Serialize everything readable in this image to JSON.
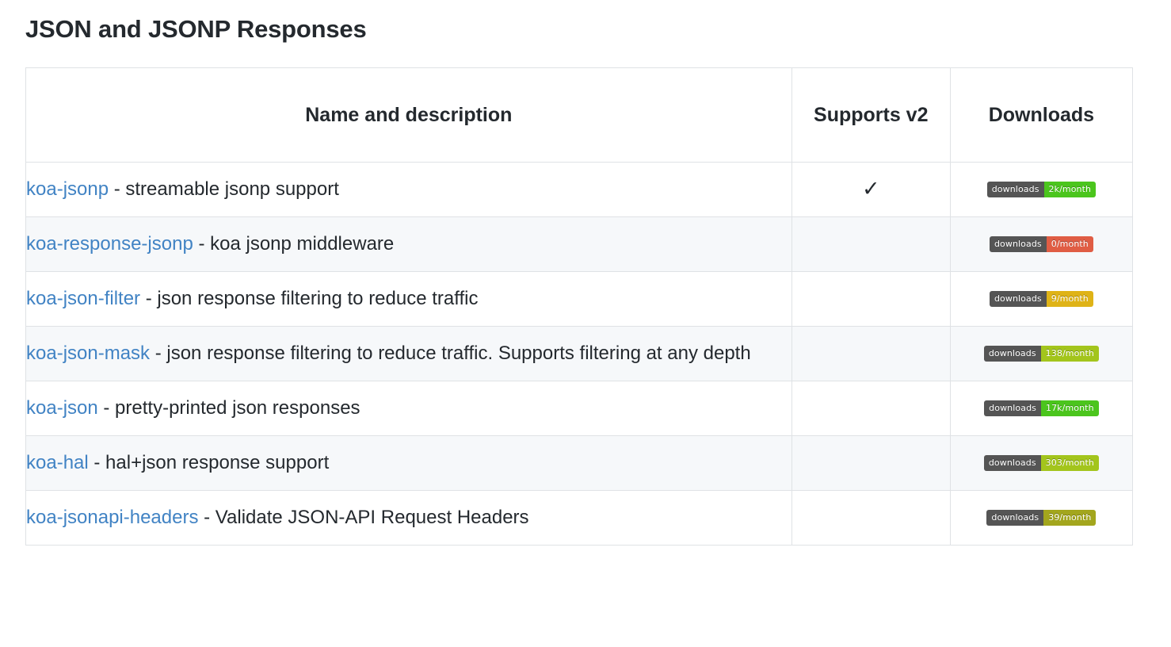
{
  "page": {
    "title": "JSON and JSONP Responses"
  },
  "table": {
    "columns": [
      {
        "key": "name",
        "label": "Name and description"
      },
      {
        "key": "v2",
        "label": "Supports v2"
      },
      {
        "key": "downloads",
        "label": "Downloads"
      }
    ],
    "check_glyph": "✓",
    "badge_label": "downloads",
    "badge_colors": {
      "brightgreen": "#4bc51d",
      "green": "#4bc51d",
      "yellowgreen": "#a3c51c",
      "olive": "#a3a61d",
      "yellow": "#dfb317",
      "red": "#e05d44",
      "label_gray": "#555555"
    },
    "rows": [
      {
        "name": "koa-jsonp",
        "separator": " - ",
        "description": "streamable jsonp support",
        "supports_v2": true,
        "downloads_label": "downloads",
        "downloads_value": "2k/month",
        "downloads_color": "#4bc51d"
      },
      {
        "name": "koa-response-jsonp",
        "separator": " - ",
        "description": "koa jsonp middleware",
        "supports_v2": false,
        "downloads_label": "downloads",
        "downloads_value": "0/month",
        "downloads_color": "#e05d44"
      },
      {
        "name": "koa-json-filter",
        "separator": " - ",
        "description": "json response filtering to reduce traffic",
        "supports_v2": false,
        "downloads_label": "downloads",
        "downloads_value": "9/month",
        "downloads_color": "#dfb317"
      },
      {
        "name": "koa-json-mask",
        "separator": " - ",
        "description": "json response filtering to reduce traffic. Supports filtering at any depth",
        "supports_v2": false,
        "downloads_label": "downloads",
        "downloads_value": "138/month",
        "downloads_color": "#a3c51c"
      },
      {
        "name": "koa-json",
        "separator": " - ",
        "description": "pretty-printed json responses",
        "supports_v2": false,
        "downloads_label": "downloads",
        "downloads_value": "17k/month",
        "downloads_color": "#4bc51d"
      },
      {
        "name": "koa-hal",
        "separator": " - ",
        "description": "hal+json response support",
        "supports_v2": false,
        "downloads_label": "downloads",
        "downloads_value": "303/month",
        "downloads_color": "#a3c51c"
      },
      {
        "name": "koa-jsonapi-headers",
        "separator": " - ",
        "description": "Validate JSON-API Request Headers",
        "supports_v2": false,
        "downloads_label": "downloads",
        "downloads_value": "39/month",
        "downloads_color": "#a3a61d"
      }
    ]
  }
}
